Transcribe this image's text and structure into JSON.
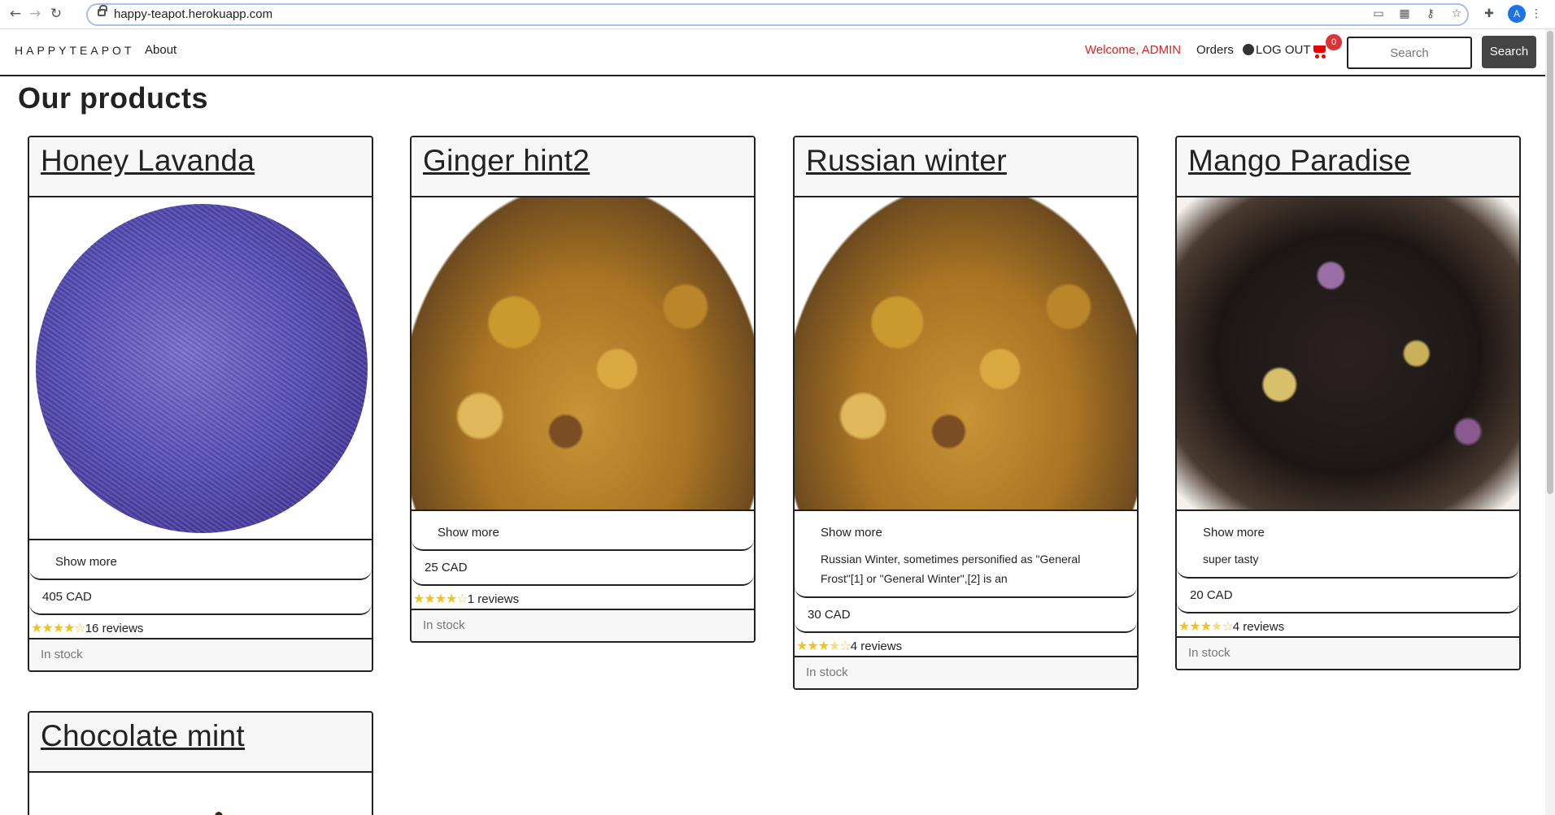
{
  "browser": {
    "url": "happy-teapot.herokuapp.com",
    "back_icon": "←",
    "forward_icon": "→",
    "reload_icon": "↻",
    "profile_initial": "A"
  },
  "nav": {
    "brand": "HAPPYTEAPOT",
    "about": "About",
    "welcome": "Welcome, ADMIN",
    "orders": "Orders",
    "logout": "LOG OUT",
    "cart_count": "0",
    "search_placeholder": "Search",
    "search_button": "Search"
  },
  "page": {
    "title": "Our products"
  },
  "products": [
    {
      "name": "Honey Lavanda",
      "show_more": "Show more",
      "description": "",
      "price": "405 CAD",
      "rating": 4,
      "reviews": "16 reviews",
      "stock": "In stock"
    },
    {
      "name": "Ginger hint2",
      "show_more": "Show more",
      "description": "",
      "price": "25 CAD",
      "rating": 4,
      "reviews": "1 reviews",
      "stock": "In stock"
    },
    {
      "name": "Russian winter",
      "show_more": "Show more",
      "description": "Russian Winter, sometimes personified as \"General Frost\"[1] or \"General Winter\",[2] is an",
      "price": "30 CAD",
      "rating": 3.5,
      "reviews": "4 reviews",
      "stock": "In stock"
    },
    {
      "name": "Mango Paradise",
      "show_more": "Show more",
      "description": "super tasty",
      "price": "20 CAD",
      "rating": 3.5,
      "reviews": "4 reviews",
      "stock": "In stock"
    },
    {
      "name": "Chocolate mint"
    }
  ],
  "colors": {
    "welcome": "#dd2222",
    "cart": "#ee0000",
    "star": "#f2c21a"
  }
}
